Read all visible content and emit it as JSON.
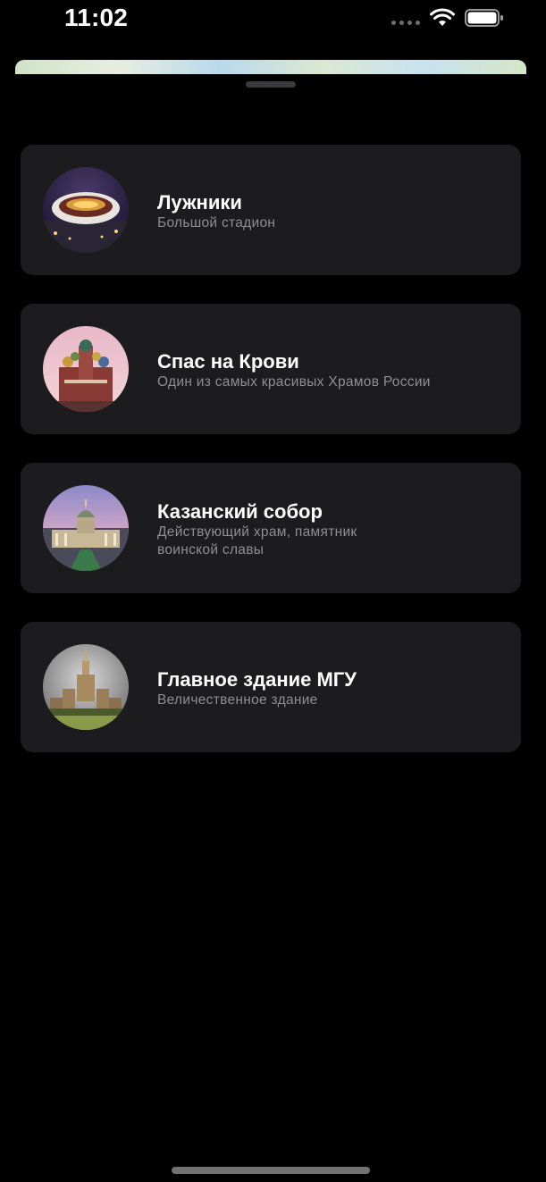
{
  "status_bar": {
    "time": "11:02",
    "signal_icon": "cellular-signal-icon",
    "wifi_icon": "wifi-icon",
    "battery_icon": "battery-icon"
  },
  "sheet": {
    "grabber_icon": "sheet-grabber"
  },
  "places": [
    {
      "title": "Лужники",
      "subtitle": "Большой стадион",
      "image": "luzhniki-stadium-photo"
    },
    {
      "title": "Спас на Крови",
      "subtitle": "Один из самых красивых Храмов России",
      "image": "savior-on-blood-church-photo"
    },
    {
      "title": "Казанский собор",
      "subtitle": "Действующий храм, памятник воинской славы",
      "image": "kazan-cathedral-photo"
    },
    {
      "title": "Главное здание МГУ",
      "subtitle": "Величественное здание",
      "image": "msu-main-building-photo"
    }
  ],
  "colors": {
    "background": "#000000",
    "card": "#1c1c1e",
    "title": "#ffffff",
    "subtitle": "#8e8e93"
  }
}
